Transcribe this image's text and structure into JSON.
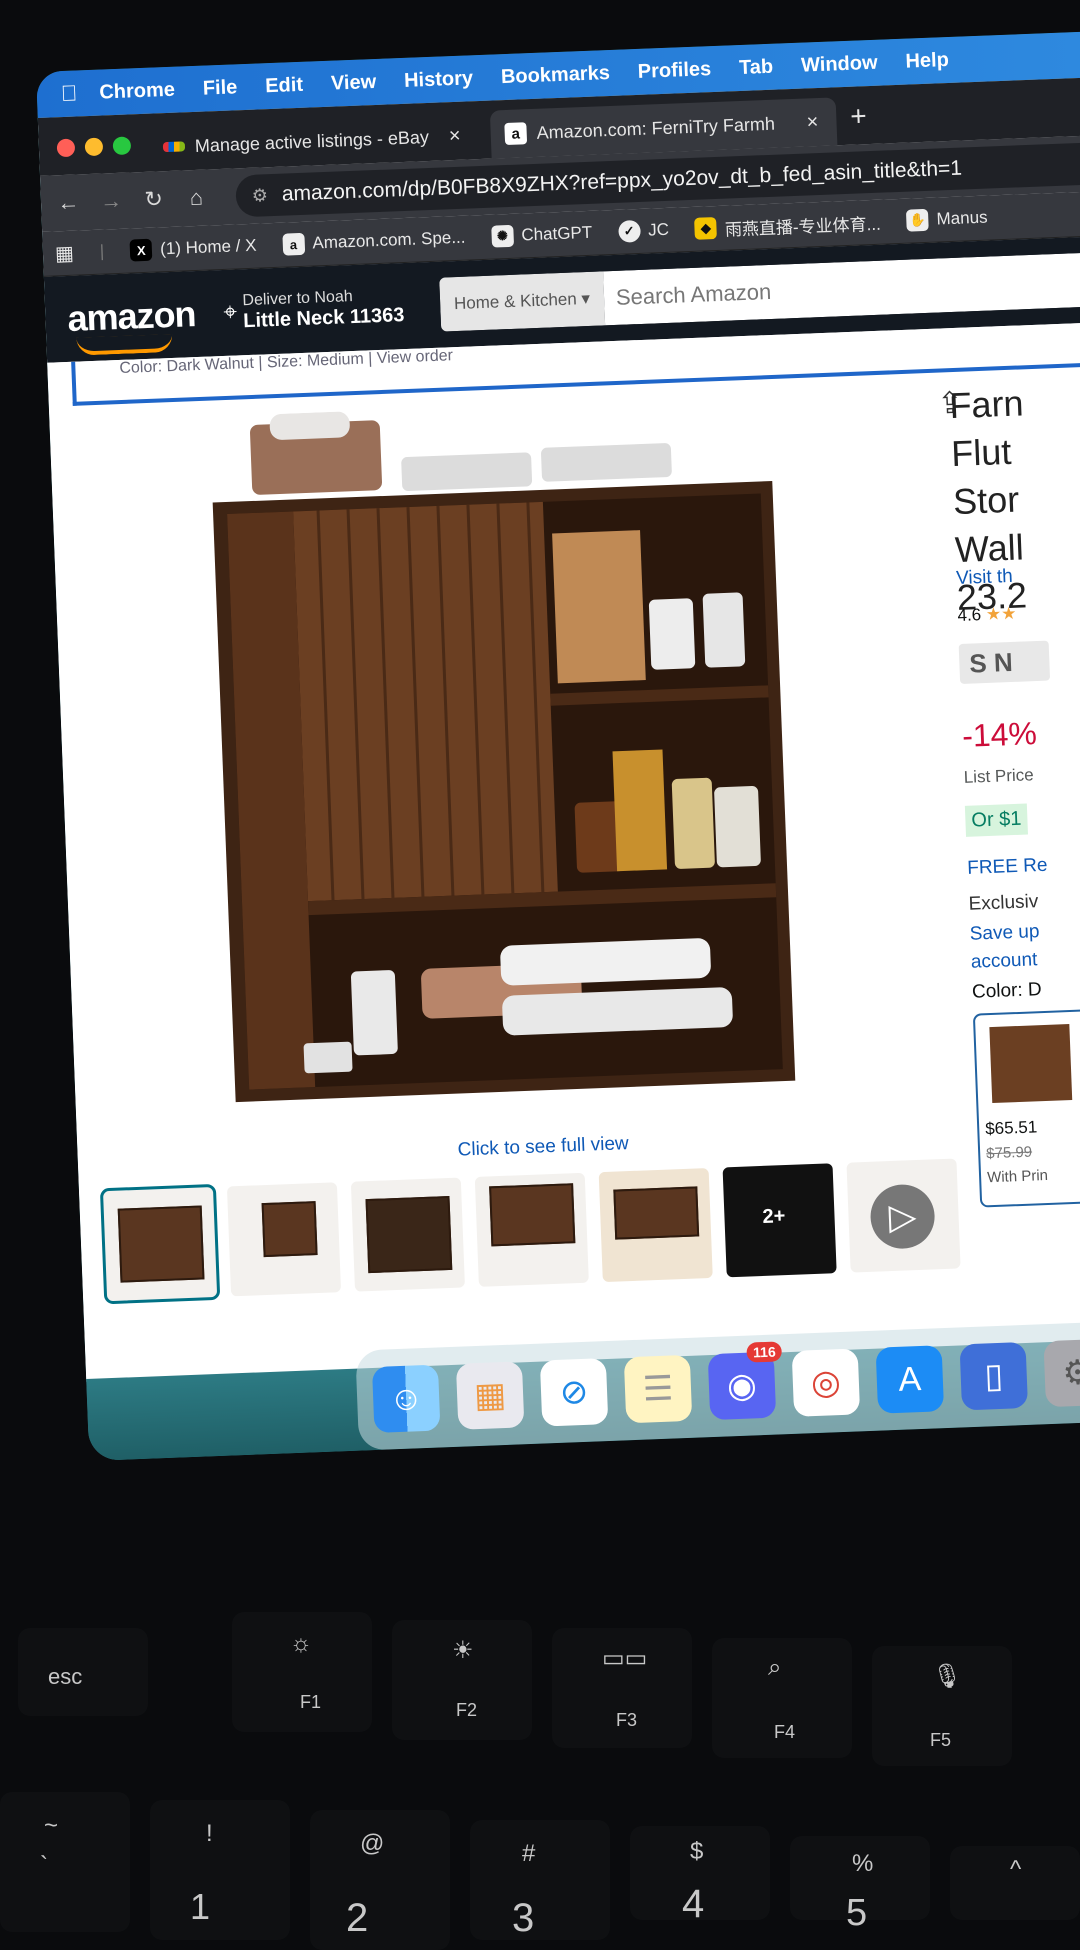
{
  "menubar": {
    "items": [
      "Chrome",
      "File",
      "Edit",
      "View",
      "History",
      "Bookmarks",
      "Profiles",
      "Tab",
      "Window",
      "Help"
    ]
  },
  "tabs": [
    {
      "title": "Manage active listings - eBay",
      "favicon": "ebay-icon"
    },
    {
      "title": "Amazon.com: FerniTry Farmh",
      "favicon": "amazon-icon"
    }
  ],
  "url": "amazon.com/dp/B0FB8X9ZHX?ref=ppx_yo2ov_dt_b_fed_asin_title&th=1",
  "bookmarks": [
    "(1) Home / X",
    "Amazon.com. Spe...",
    "ChatGPT",
    "JC",
    "雨燕直播-专业体育...",
    "Manus"
  ],
  "amazon": {
    "logo": "amazon",
    "deliver_line1": "Deliver to Noah",
    "deliver_line2": "Little Neck 11363",
    "dept": "Home & Kitchen",
    "search_placeholder": "Search Amazon"
  },
  "variant_strip": "Color: Dark Walnut | Size: Medium | View order",
  "product": {
    "caption": "Click to see full view",
    "title_lines": [
      "Farn",
      "Flut",
      "Stor",
      "Wall",
      "23.2"
    ],
    "visit": "Visit th",
    "rating": "4.6",
    "badge": "S N",
    "discount": "-14%",
    "list_price": "List Price",
    "or_price": "Or $1",
    "free": "FREE Re",
    "exclusive": "Exclusiv",
    "save": "Save up",
    "account": "account",
    "color_label": "Color: D",
    "swatch_price": "$65.51",
    "swatch_list": "$75.99",
    "swatch_prime": "With Prin",
    "more_images": "2+"
  },
  "dock": {
    "apps": [
      "Finder",
      "Launchpad",
      "Safari",
      "Notes",
      "Discord",
      "Chrome",
      "App Store",
      "iPhone Mirroring",
      "System Settings"
    ],
    "discord_badge": "116"
  },
  "keyboard": {
    "fn_keys": [
      "esc",
      "F1",
      "F2",
      "F3",
      "F4",
      "F5"
    ],
    "number_row": [
      {
        "top": "~",
        "bottom": "`"
      },
      {
        "top": "!",
        "bottom": "1"
      },
      {
        "top": "@",
        "bottom": "2"
      },
      {
        "top": "#",
        "bottom": "3"
      },
      {
        "top": "$",
        "bottom": "4"
      },
      {
        "top": "%",
        "bottom": "5"
      },
      {
        "top": "^",
        "bottom": ""
      }
    ]
  }
}
